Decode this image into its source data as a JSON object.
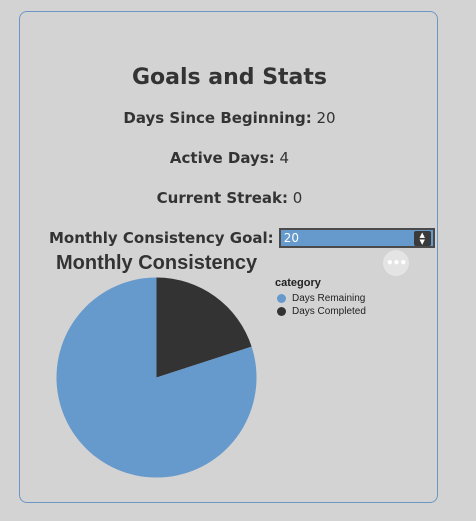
{
  "header": {
    "title": "Goals and Stats"
  },
  "stats": {
    "days_since_beginning_label": "Days Since Beginning:",
    "days_since_beginning_value": "20",
    "active_days_label": "Active Days:",
    "active_days_value": "4",
    "current_streak_label": "Current Streak:",
    "current_streak_value": "0"
  },
  "goal": {
    "label": "Monthly Consistency Goal:",
    "value": "20"
  },
  "chart": {
    "more_icon": "more-dots-icon"
  },
  "chart_data": {
    "type": "pie",
    "title": "Monthly Consistency",
    "legend_title": "category",
    "legend_position": "right",
    "slices": [
      {
        "label": "Days Remaining",
        "value": 16,
        "color": "#6699cc"
      },
      {
        "label": "Days Completed",
        "value": 4,
        "color": "#333333"
      }
    ]
  },
  "colors": {
    "background": "#d3d3d3",
    "panel_border": "#6c97c4",
    "accent": "#6699cc",
    "dark": "#333333"
  }
}
